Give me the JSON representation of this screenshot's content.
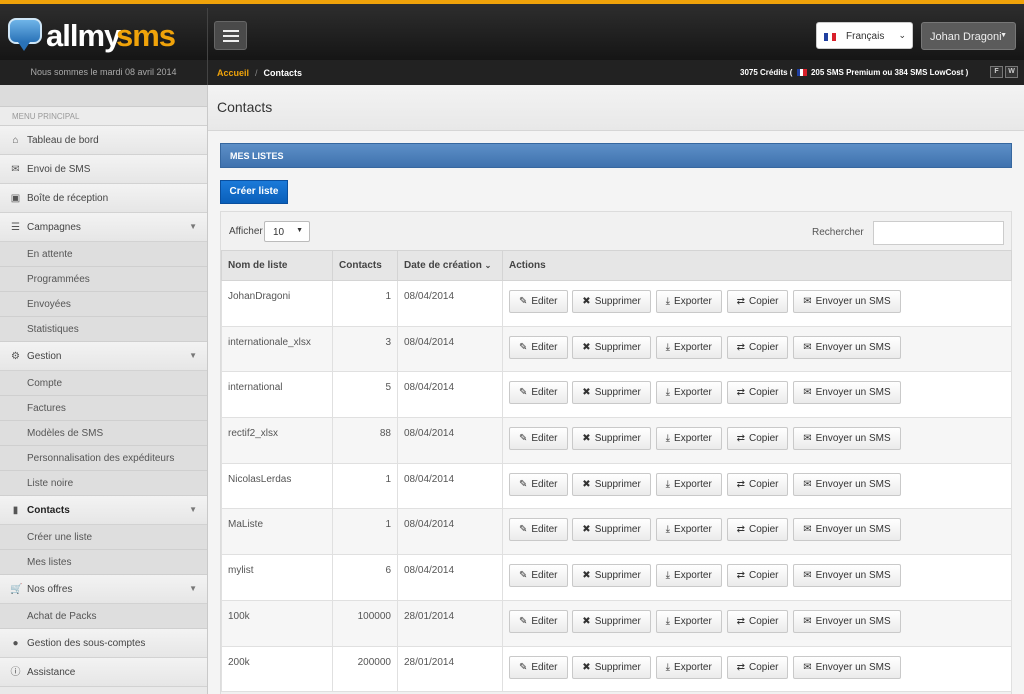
{
  "brand": {
    "part1": "allmy",
    "part2": "sms"
  },
  "header": {
    "language": "Français",
    "user": "Johan Dragoni",
    "date_text": "Nous sommes le mardi 08 avril 2014"
  },
  "breadcrumb": {
    "home": "Accueil",
    "current": "Contacts"
  },
  "credits": {
    "prefix": "3075 Crédits (",
    "suffix": "205 SMS Premium ou 384 SMS LowCost )",
    "btn_f": "F",
    "btn_w": "W"
  },
  "sidebar": {
    "title": "MENU PRINCIPAL",
    "items": [
      {
        "label": "Tableau de bord",
        "icon": "home-icon"
      },
      {
        "label": "Envoi de SMS",
        "icon": "envelope-icon"
      },
      {
        "label": "Boîte de réception",
        "icon": "inbox-icon"
      },
      {
        "label": "Campagnes",
        "icon": "list-icon"
      },
      {
        "label": "Gestion",
        "icon": "gear-icon"
      },
      {
        "label": "Contacts",
        "icon": "book-icon"
      },
      {
        "label": "Nos offres",
        "icon": "cart-icon"
      },
      {
        "label": "Gestion des sous-comptes",
        "icon": "user-icon"
      },
      {
        "label": "Assistance",
        "icon": "info-icon"
      }
    ],
    "campagnes_sub": [
      "En attente",
      "Programmées",
      "Envoyées",
      "Statistiques"
    ],
    "gestion_sub": [
      "Compte",
      "Factures",
      "Modèles de SMS",
      "Personnalisation des expéditeurs",
      "Liste noire"
    ],
    "contacts_sub": [
      "Créer une liste",
      "Mes listes"
    ],
    "offres_sub": [
      "Achat de Packs"
    ]
  },
  "page": {
    "title": "Contacts",
    "panel_title": "MES LISTES",
    "create_button": "Créer liste",
    "show_label": "Afficher",
    "show_value": "10",
    "search_label": "Rechercher",
    "search_value": ""
  },
  "table": {
    "columns": [
      "Nom de liste",
      "Contacts",
      "Date de création",
      "Actions"
    ],
    "action_labels": {
      "edit": "Editer",
      "delete": "Supprimer",
      "export": "Exporter",
      "copy": "Copier",
      "send": "Envoyer un SMS"
    },
    "rows": [
      {
        "name": "JohanDragoni",
        "contacts": "1",
        "date": "08/04/2014"
      },
      {
        "name": "internationale_xlsx",
        "contacts": "3",
        "date": "08/04/2014"
      },
      {
        "name": "international",
        "contacts": "5",
        "date": "08/04/2014"
      },
      {
        "name": "rectif2_xlsx",
        "contacts": "88",
        "date": "08/04/2014"
      },
      {
        "name": "NicolasLerdas",
        "contacts": "1",
        "date": "08/04/2014"
      },
      {
        "name": "MaListe",
        "contacts": "1",
        "date": "08/04/2014"
      },
      {
        "name": "mylist",
        "contacts": "6",
        "date": "08/04/2014"
      },
      {
        "name": "100k",
        "contacts": "100000",
        "date": "28/01/2014"
      },
      {
        "name": "200k",
        "contacts": "200000",
        "date": "28/01/2014"
      }
    ]
  },
  "colors": {
    "accent": "#f0a30a",
    "primary": "#0a5fba",
    "panel": "#4a7db8"
  }
}
